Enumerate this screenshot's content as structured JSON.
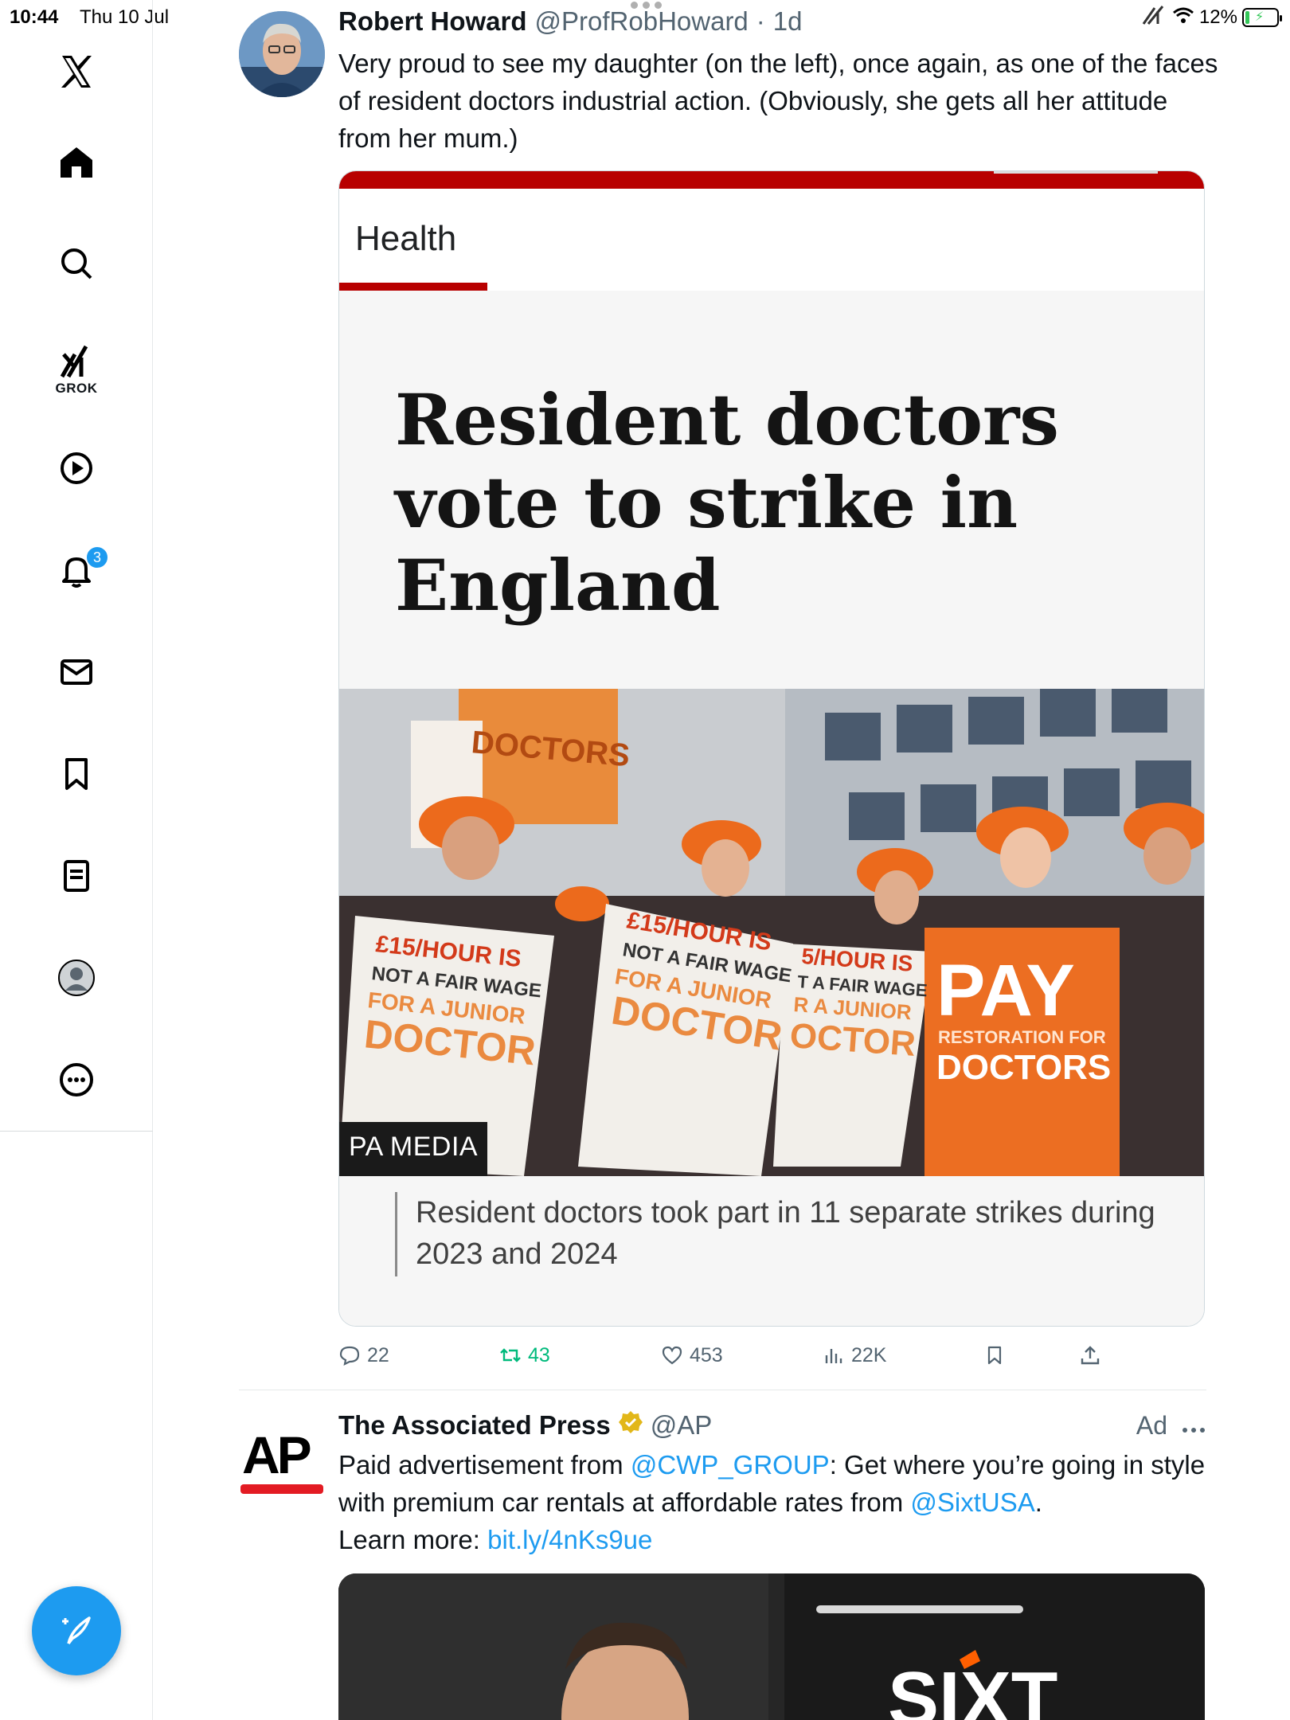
{
  "status_bar": {
    "time": "10:44",
    "date": "Thu 10 Jul",
    "battery": "12%"
  },
  "sidebar": {
    "items": [
      {
        "name": "x-logo",
        "icon": "x-logo-icon"
      },
      {
        "name": "home",
        "icon": "home-icon"
      },
      {
        "name": "explore",
        "icon": "search-icon"
      },
      {
        "name": "grok",
        "icon": "grok-icon",
        "label": "GROK"
      },
      {
        "name": "videos",
        "icon": "play-icon"
      },
      {
        "name": "notifications",
        "icon": "bell-icon",
        "badge": "3"
      },
      {
        "name": "messages",
        "icon": "mail-icon"
      },
      {
        "name": "bookmarks",
        "icon": "bookmark-icon"
      },
      {
        "name": "lists",
        "icon": "list-icon"
      },
      {
        "name": "profile",
        "icon": "profile-icon"
      },
      {
        "name": "more",
        "icon": "more-icon"
      }
    ],
    "compose_icon": "compose-icon"
  },
  "tweet": {
    "author": "Robert Howard",
    "handle": "@ProfRobHoward",
    "separator": "·",
    "time_ago": "1d",
    "text": "Very proud to see my daughter (on the left), once again, as one of the faces of resident doctors industrial action. (Obviously, she gets all her attitude from her mum.)",
    "card": {
      "section": "Health",
      "headline": "Resident doctors vote to strike in England",
      "photo_credit": "PA MEDIA",
      "caption": "Resident doctors took part in 11 separate strikes during 2023 and 2024",
      "accent_color": "#b80000"
    },
    "actions": {
      "replies": "22",
      "retweets": "43",
      "likes": "453",
      "views": "22K"
    }
  },
  "ad": {
    "author": "The Associated Press",
    "handle": "@AP",
    "label": "Ad",
    "text_prefix": "Paid advertisement from ",
    "mention_1": "@CWP_GROUP",
    "text_middle": ": Get where you’re going in style with premium car rentals at affordable rates from ",
    "mention_2": "@SixtUSA",
    "text_end": ".",
    "learn_more_label": "Learn more: ",
    "link": "bit.ly/4nKs9ue",
    "logo_text": "AP",
    "media_brand": "SIXT"
  },
  "colors": {
    "accent_blue": "#1d9bf0",
    "retweet_green": "#00ba7c",
    "secondary_text": "#536471"
  }
}
